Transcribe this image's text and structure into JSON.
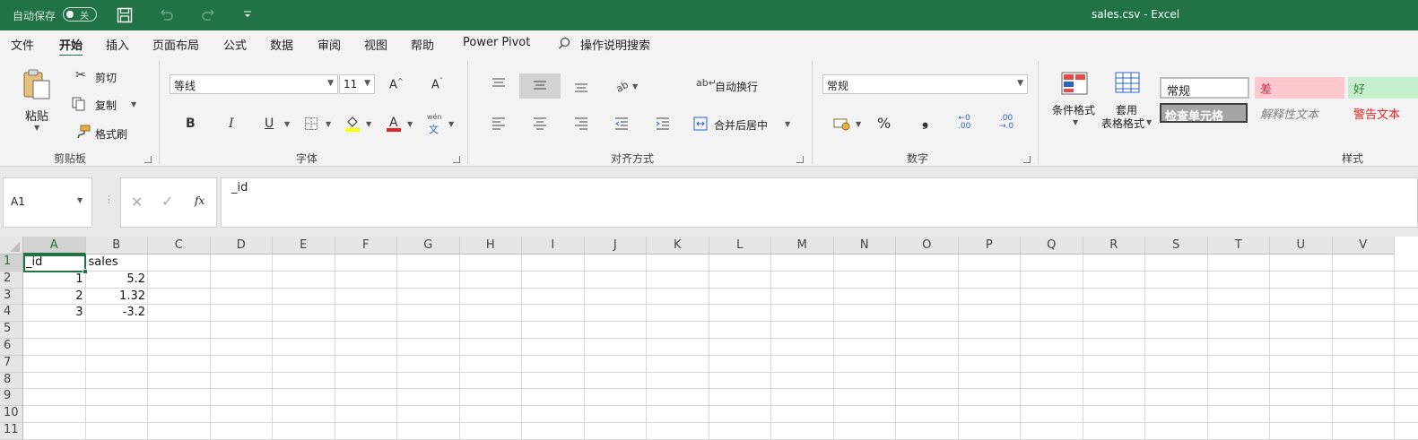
{
  "titlebar": {
    "autosave_label": "自动保存",
    "autosave_state": "关",
    "title": "sales.csv  -  Excel"
  },
  "menu": {
    "tabs": [
      "文件",
      "开始",
      "插入",
      "页面布局",
      "公式",
      "数据",
      "审阅",
      "视图",
      "帮助",
      "Power Pivot"
    ],
    "active": "开始",
    "search_label": "操作说明搜索"
  },
  "ribbon": {
    "clipboard": {
      "paste": "粘贴",
      "cut": "剪切",
      "copy": "复制",
      "format_painter": "格式刷",
      "label": "剪贴板"
    },
    "font": {
      "font_name": "等线",
      "font_size": "11",
      "bold": "B",
      "italic": "I",
      "underline": "U",
      "label": "字体",
      "phonetic_top": "wén",
      "phonetic_bottom": "文"
    },
    "alignment": {
      "wrap_text": "自动换行",
      "merge_center": "合并后居中",
      "label": "对齐方式"
    },
    "number": {
      "format": "常规",
      "percent": "%",
      "comma": "9",
      "label": "数字"
    },
    "styles": {
      "conditional_format": "条件格式",
      "table_format_line1": "套用",
      "table_format_line2": "表格格式",
      "normal": "常规",
      "bad": "差",
      "good": "好",
      "check_cell": "检查单元格",
      "explanatory": "解释性文本",
      "warning": "警告文本",
      "label": "样式"
    }
  },
  "formula_bar": {
    "name_box": "A1",
    "fx": "fx",
    "content": "_id"
  },
  "grid": {
    "columns": [
      "A",
      "B",
      "C",
      "D",
      "E",
      "F",
      "G",
      "H",
      "I",
      "J",
      "K",
      "L",
      "M",
      "N",
      "O",
      "P",
      "Q",
      "R",
      "S",
      "T",
      "U",
      "V"
    ],
    "rows": [
      "1",
      "2",
      "3",
      "4",
      "5",
      "6",
      "7",
      "8",
      "9",
      "10",
      "11"
    ],
    "selected_cell": "A1",
    "cells": {
      "A1": "_id",
      "B1": "sales",
      "A2": "1",
      "B2": "5.2",
      "A3": "2",
      "B3": "1.32",
      "A4": "3",
      "B4": "-3.2"
    }
  },
  "colors": {
    "accent": "#217346"
  }
}
